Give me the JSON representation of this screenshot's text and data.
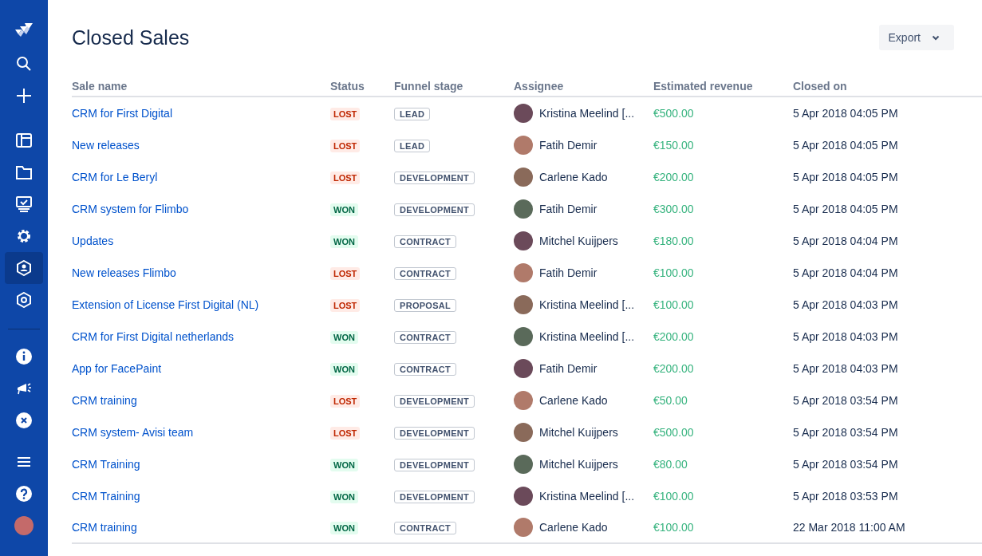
{
  "sidebar": {
    "top": [
      {
        "kind": "logo",
        "selected": false
      },
      {
        "kind": "search",
        "selected": false
      },
      {
        "kind": "plus",
        "selected": false
      }
    ],
    "middle": [
      {
        "kind": "board",
        "selected": false
      },
      {
        "kind": "folder",
        "selected": false
      },
      {
        "kind": "monitor",
        "selected": false
      },
      {
        "kind": "gear",
        "selected": false
      },
      {
        "kind": "user-hexagon",
        "selected": true
      },
      {
        "kind": "hexagon",
        "selected": false
      }
    ],
    "bottom": [
      {
        "kind": "info",
        "selected": false
      },
      {
        "kind": "megaphone",
        "selected": false
      },
      {
        "kind": "close",
        "selected": false
      },
      {
        "kind": "menu",
        "selected": false
      },
      {
        "kind": "help",
        "selected": false
      },
      {
        "kind": "avatar",
        "selected": false
      }
    ]
  },
  "page": {
    "title": "Closed Sales",
    "export_button": "Export"
  },
  "table": {
    "columns": [
      "Sale name",
      "Status",
      "Funnel stage",
      "Assignee",
      "Estimated revenue",
      "Closed on"
    ],
    "rows": [
      {
        "name": "CRM for First Digital",
        "status": {
          "kind": "lost",
          "label": "LOST"
        },
        "stage": "LEAD",
        "assignee": "Kristina Meelind [...",
        "revenue": "€500.00",
        "closed": "5 Apr 2018 04:05 PM"
      },
      {
        "name": "New releases",
        "status": {
          "kind": "lost",
          "label": "LOST"
        },
        "stage": "LEAD",
        "assignee": "Fatih Demir",
        "revenue": "€150.00",
        "closed": "5 Apr 2018 04:05 PM"
      },
      {
        "name": "CRM for Le Beryl",
        "status": {
          "kind": "lost",
          "label": "LOST"
        },
        "stage": "DEVELOPMENT",
        "assignee": "Carlene Kado",
        "revenue": "€200.00",
        "closed": "5 Apr 2018 04:05 PM"
      },
      {
        "name": "CRM system for Flimbo",
        "status": {
          "kind": "won",
          "label": "WON"
        },
        "stage": "DEVELOPMENT",
        "assignee": "Fatih Demir",
        "revenue": "€300.00",
        "closed": "5 Apr 2018 04:05 PM"
      },
      {
        "name": "Updates",
        "status": {
          "kind": "won",
          "label": "WON"
        },
        "stage": "CONTRACT",
        "assignee": "Mitchel Kuijpers",
        "revenue": "€180.00",
        "closed": "5 Apr 2018 04:04 PM"
      },
      {
        "name": "New releases Flimbo",
        "status": {
          "kind": "lost",
          "label": "LOST"
        },
        "stage": "CONTRACT",
        "assignee": "Fatih Demir",
        "revenue": "€100.00",
        "closed": "5 Apr 2018 04:04 PM"
      },
      {
        "name": "Extension of License First Digital (NL)",
        "status": {
          "kind": "lost",
          "label": "LOST"
        },
        "stage": "PROPOSAL",
        "assignee": "Kristina Meelind [...",
        "revenue": "€100.00",
        "closed": "5 Apr 2018 04:03 PM"
      },
      {
        "name": "CRM for First Digital netherlands",
        "status": {
          "kind": "won",
          "label": "WON"
        },
        "stage": "CONTRACT",
        "assignee": "Kristina Meelind [...",
        "revenue": "€200.00",
        "closed": "5 Apr 2018 04:03 PM"
      },
      {
        "name": "App for FacePaint",
        "status": {
          "kind": "won",
          "label": "WON"
        },
        "stage": "CONTRACT",
        "assignee": "Fatih Demir",
        "revenue": "€200.00",
        "closed": "5 Apr 2018 04:03 PM"
      },
      {
        "name": "CRM training",
        "status": {
          "kind": "lost",
          "label": "LOST"
        },
        "stage": "DEVELOPMENT",
        "assignee": "Carlene Kado",
        "revenue": "€50.00",
        "closed": "5 Apr 2018 03:54 PM"
      },
      {
        "name": "CRM system- Avisi team",
        "status": {
          "kind": "lost",
          "label": "LOST"
        },
        "stage": "DEVELOPMENT",
        "assignee": "Mitchel Kuijpers",
        "revenue": "€500.00",
        "closed": "5 Apr 2018 03:54 PM"
      },
      {
        "name": "CRM Training",
        "status": {
          "kind": "won",
          "label": "WON"
        },
        "stage": "DEVELOPMENT",
        "assignee": "Mitchel Kuijpers",
        "revenue": "€80.00",
        "closed": "5 Apr 2018 03:54 PM"
      },
      {
        "name": "CRM Training",
        "status": {
          "kind": "won",
          "label": "WON"
        },
        "stage": "DEVELOPMENT",
        "assignee": "Kristina Meelind [...",
        "revenue": "€100.00",
        "closed": "5 Apr 2018 03:53 PM"
      },
      {
        "name": "CRM training",
        "status": {
          "kind": "won",
          "label": "WON"
        },
        "stage": "CONTRACT",
        "assignee": "Carlene Kado",
        "revenue": "€100.00",
        "closed": "22 Mar 2018 11:00 AM"
      }
    ]
  }
}
